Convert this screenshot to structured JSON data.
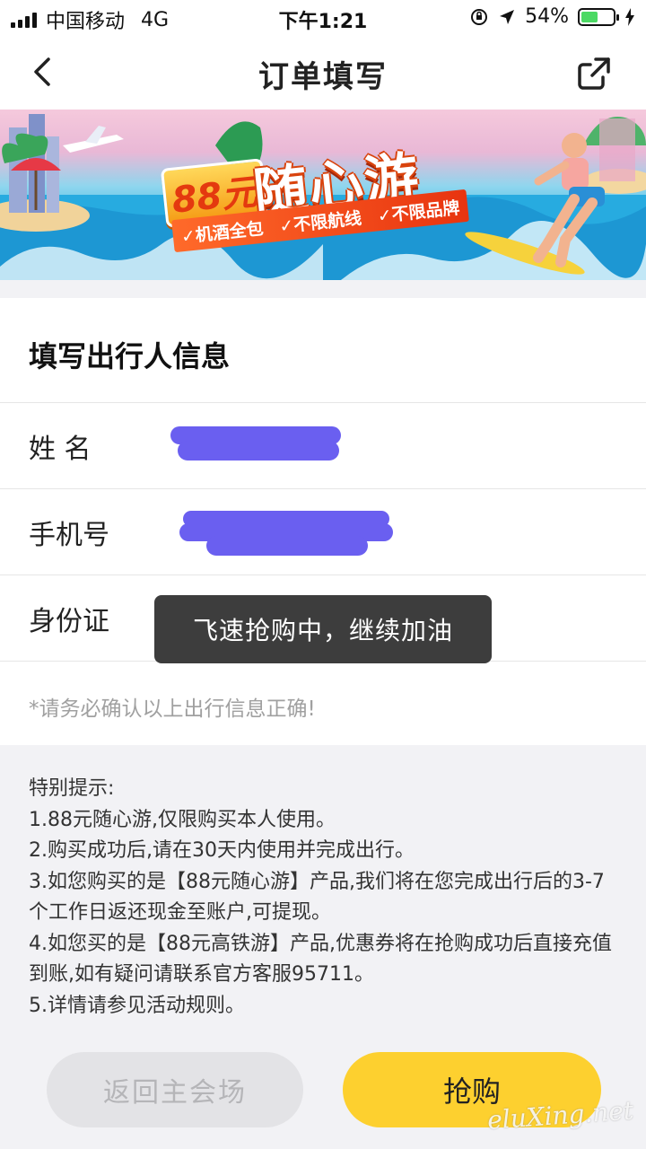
{
  "status_bar": {
    "carrier": "中国移动",
    "network": "4G",
    "time": "下午1:21",
    "battery": "54%",
    "battery_level": 0.54
  },
  "nav": {
    "title": "订单填写",
    "back_icon": "chevron-left-icon",
    "share_icon": "share-external-icon"
  },
  "banner": {
    "price": "88元",
    "title": "随心游",
    "features": [
      "✓机酒全包",
      "✓不限航线",
      "✓不限品牌"
    ]
  },
  "form": {
    "heading": "填写出行人信息",
    "fields": [
      {
        "label": "姓 名"
      },
      {
        "label": "手机号"
      },
      {
        "label": "身份证"
      }
    ],
    "note": "*请务必确认以上出行信息正确!"
  },
  "tips": {
    "text": "特别提示:\n1.88元随心游,仅限购买本人使用。\n2.购买成功后,请在30天内使用并完成出行。\n3.如您购买的是【88元随心游】产品,我们将在您完成出行后的3-7个工作日返还现金至账户,可提现。\n4.如您买的是【88元高铁游】产品,优惠券将在抢购成功后直接充值到账,如有疑问请联系官方客服95711。\n5.详情请参见活动规则。"
  },
  "buttons": {
    "back_main": "返回主会场",
    "buy": "抢购"
  },
  "toast": {
    "message": "飞速抢购中，继续加油"
  },
  "watermark": "eluXing.net",
  "colors": {
    "accent_yellow": "#fdd02f",
    "redaction": "#6a5ff0"
  }
}
